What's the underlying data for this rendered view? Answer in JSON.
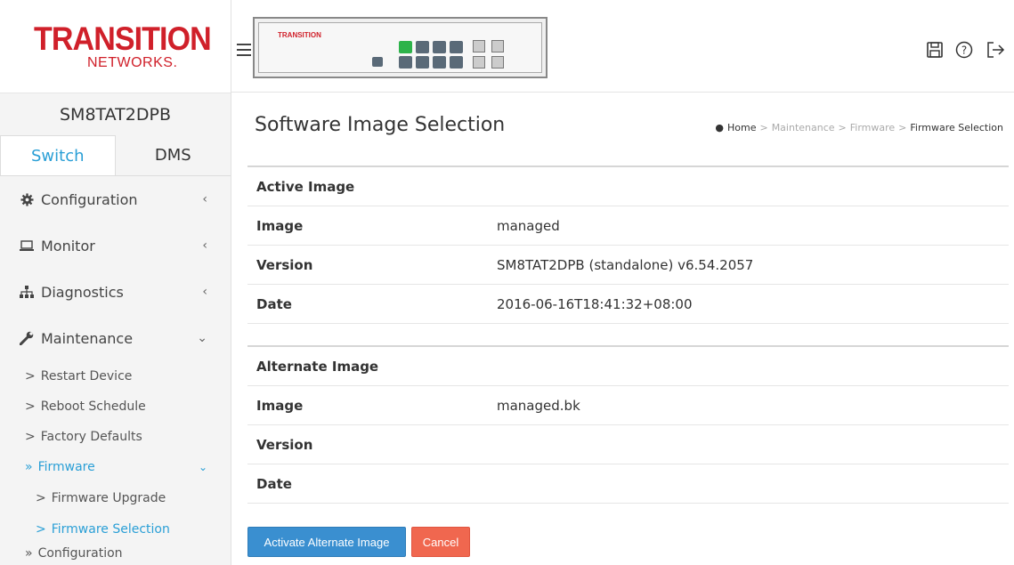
{
  "brand": {
    "logo_main": "TRANSITION",
    "logo_sub": "NETWORKS.",
    "panel_logo": "TRANSITION",
    "accent": "#d0202a"
  },
  "device": {
    "name": "SM8TAT2DPB"
  },
  "tabs": [
    {
      "label": "Switch",
      "active": true
    },
    {
      "label": "DMS",
      "active": false
    }
  ],
  "menu": {
    "configuration": "Configuration",
    "monitor": "Monitor",
    "diagnostics": "Diagnostics",
    "maintenance": "Maintenance",
    "maintenance_items": {
      "restart": "Restart Device",
      "reboot": "Reboot Schedule",
      "factory": "Factory Defaults",
      "firmware": "Firmware",
      "firmware_upgrade": "Firmware Upgrade",
      "firmware_selection": "Firmware Selection",
      "configuration": "Configuration"
    }
  },
  "page": {
    "title": "Software Image Selection"
  },
  "breadcrumb": {
    "home": "Home",
    "b1": "Maintenance",
    "b2": "Firmware",
    "b3": "Firmware Selection"
  },
  "active_image": {
    "heading": "Active Image",
    "rows": [
      {
        "label": "Image",
        "value": "managed"
      },
      {
        "label": "Version",
        "value": "SM8TAT2DPB (standalone) v6.54.2057"
      },
      {
        "label": "Date",
        "value": "2016-06-16T18:41:32+08:00"
      }
    ]
  },
  "alternate_image": {
    "heading": "Alternate Image",
    "rows": [
      {
        "label": "Image",
        "value": "managed.bk"
      },
      {
        "label": "Version",
        "value": ""
      },
      {
        "label": "Date",
        "value": ""
      }
    ]
  },
  "buttons": {
    "activate": "Activate Alternate Image",
    "cancel": "Cancel"
  },
  "header_icons": [
    "save-icon",
    "help-icon",
    "logout-icon"
  ]
}
